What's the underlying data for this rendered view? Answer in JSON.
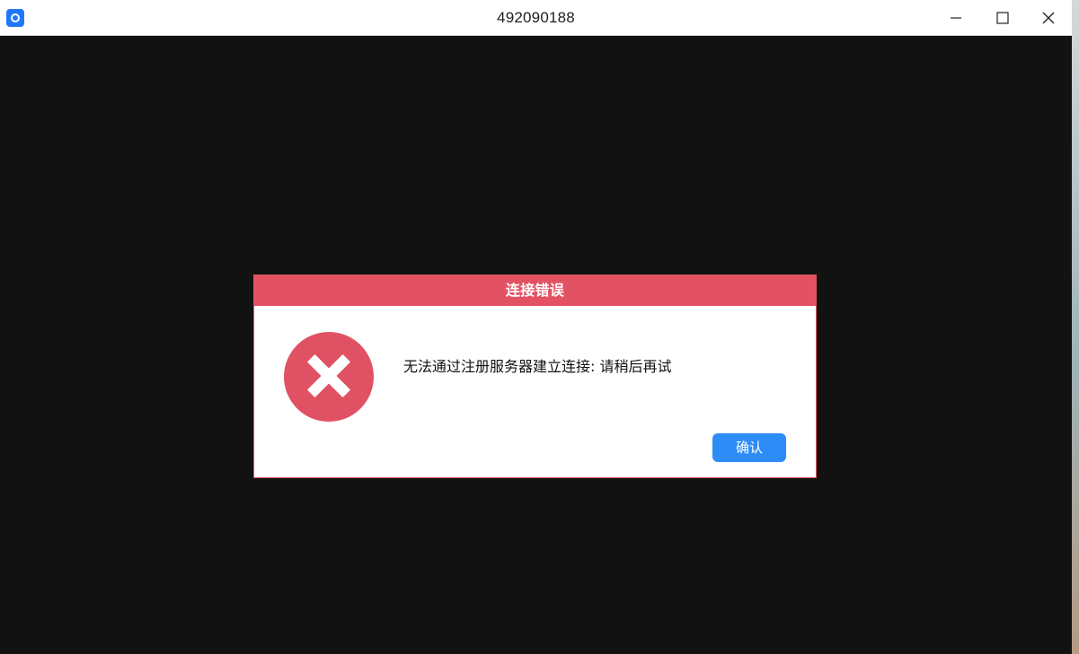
{
  "window": {
    "title": "492090188",
    "icon": "app-logo-icon",
    "controls": {
      "minimize": "minimize-icon",
      "maximize": "maximize-icon",
      "close": "close-icon"
    }
  },
  "dialog": {
    "title": "连接错误",
    "message": "无法通过注册服务器建立连接: 请稍后再试",
    "confirm_label": "确认",
    "icon": "error-x-icon"
  },
  "colors": {
    "dialog_accent": "#e25262",
    "button_primary": "#2e8cf6",
    "background": "#121212"
  }
}
